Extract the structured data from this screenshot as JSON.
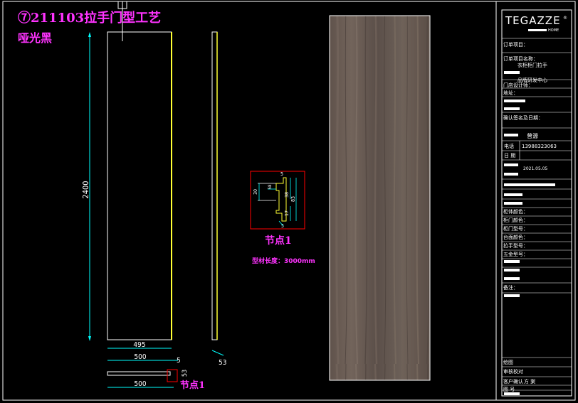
{
  "drawing": {
    "title_line1": "⑦211103拉手门型工艺",
    "title_line2": "哑光黑",
    "node_label": "节点1",
    "node_label_bottom": "节点1",
    "profile_length_note": "型材长度：3000mm"
  },
  "dimensions": {
    "height": "2400",
    "inner_width": "495",
    "outer_width": "500",
    "gap": "5",
    "side_depth": "53",
    "bottom_width": "500",
    "bottom_depth": "53",
    "node_30": "30",
    "node_38": "38",
    "node_83": "83",
    "node_58": "58",
    "node_17": "17",
    "node_5": "5",
    "node_top": "5"
  },
  "title_block": {
    "brand": "TEGAZZE",
    "brand_sub": "HOME",
    "project_label": "订单项目：",
    "product_label": "订单项目名称：",
    "product_value": "衣柜柜门拉手",
    "dept_value": "品牌研发中心",
    "designer_label": "门店设计师：",
    "address_label": "地址：",
    "confirm_label": "确认签名及日期：",
    "customer_value": "曾源",
    "phone_label": "电话",
    "phone_value": "13988323063",
    "date_label": "日 期",
    "date_value": "2021.05.05",
    "rows": [
      "柜体颜色：",
      "柜门颜色：",
      "柜门型号：",
      "台面颜色：",
      "拉手型号：",
      "五金型号：",
      "备注："
    ],
    "footer": [
      "绘图",
      "审核校对",
      "客户确认",
      "图 号"
    ],
    "footer_value": "方 案"
  },
  "wood_panel": {
    "color": "#6e625a"
  }
}
